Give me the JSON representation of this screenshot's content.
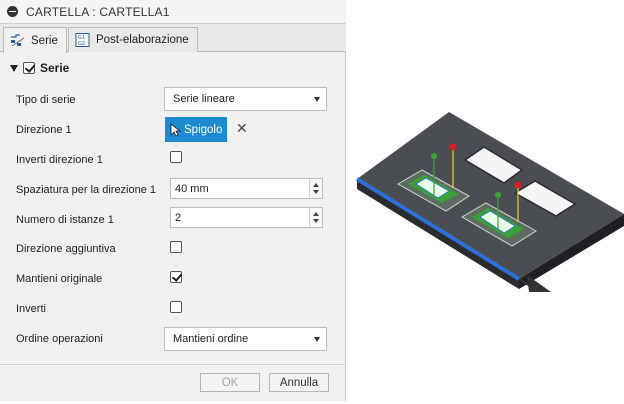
{
  "dialog": {
    "title": "CARTELLA : CARTELLA1",
    "tabs": [
      {
        "label": "Serie",
        "icon": "pattern-icon",
        "active": true
      },
      {
        "label": "Post-elaborazione",
        "icon": "post-processing-icon",
        "active": false
      }
    ],
    "group": {
      "label": "Serie",
      "checked": true
    },
    "rows": {
      "pattern_type": {
        "label": "Tipo di serie",
        "value": "Serie lineare"
      },
      "direction1": {
        "label": "Direzione 1",
        "button_label": "Spigolo"
      },
      "invert_direction1": {
        "label": "Inverti direzione 1",
        "checked": false
      },
      "spacing1": {
        "label": "Spaziatura per la direzione 1",
        "value": "40 mm"
      },
      "instances1": {
        "label": "Numero di istanze 1",
        "value": "2"
      },
      "extra_direction": {
        "label": "Direzione aggiuntiva",
        "checked": false
      },
      "keep_original": {
        "label": "Mantieni originale",
        "checked": true
      },
      "invert": {
        "label": "Inverti",
        "checked": false
      },
      "operation_order": {
        "label": "Ordine operazioni",
        "value": "Mantieni ordine"
      }
    },
    "buttons": {
      "ok": "OK",
      "cancel": "Annulla"
    }
  },
  "colors": {
    "select_button": "#1d8bd2",
    "edge_highlight": "#2d6fd6",
    "pocket_green": "#3aa335",
    "plate": "#4a4d52"
  }
}
